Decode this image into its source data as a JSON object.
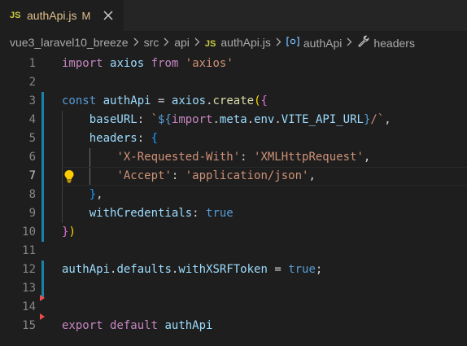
{
  "tab": {
    "badge": "JS",
    "title": "authApi.js",
    "status": "M"
  },
  "breadcrumb": {
    "project": "vue3_laravel10_breeze",
    "folder1": "src",
    "folder2": "api",
    "file_badge": "JS",
    "file": "authApi.js",
    "symbol": "authApi",
    "property": "headers"
  },
  "editor": {
    "active_line": 7,
    "line_numbers": [
      "1",
      "2",
      "3",
      "4",
      "5",
      "6",
      "7",
      "8",
      "9",
      "10",
      "11",
      "12",
      "13",
      "14",
      "15"
    ],
    "lines": [
      [
        {
          "t": "import",
          "c": "k"
        },
        {
          "t": " "
        },
        {
          "t": "axios",
          "c": "v"
        },
        {
          "t": " "
        },
        {
          "t": "from",
          "c": "k"
        },
        {
          "t": " "
        },
        {
          "t": "'axios'",
          "c": "s"
        }
      ],
      [],
      [
        {
          "t": "const",
          "c": "b"
        },
        {
          "t": " "
        },
        {
          "t": "authApi",
          "c": "v"
        },
        {
          "t": " = "
        },
        {
          "t": "axios",
          "c": "v"
        },
        {
          "t": "."
        },
        {
          "t": "create",
          "c": "f"
        },
        {
          "t": "(",
          "c": "y"
        },
        {
          "t": "{",
          "c": "p"
        }
      ],
      [
        {
          "t": "    "
        },
        {
          "t": "baseURL",
          "c": "v"
        },
        {
          "t": ": "
        },
        {
          "t": "`",
          "c": "s"
        },
        {
          "t": "${",
          "c": "b"
        },
        {
          "t": "import",
          "c": "k"
        },
        {
          "t": "."
        },
        {
          "t": "meta",
          "c": "v"
        },
        {
          "t": "."
        },
        {
          "t": "env",
          "c": "v"
        },
        {
          "t": "."
        },
        {
          "t": "VITE_API_URL",
          "c": "v"
        },
        {
          "t": "}",
          "c": "b"
        },
        {
          "t": "/`",
          "c": "s"
        },
        {
          "t": ","
        }
      ],
      [
        {
          "t": "    "
        },
        {
          "t": "headers",
          "c": "v"
        },
        {
          "t": ": "
        },
        {
          "t": "{",
          "c": "bb"
        }
      ],
      [
        {
          "t": "        "
        },
        {
          "t": "'X-Requested-With'",
          "c": "s"
        },
        {
          "t": ": "
        },
        {
          "t": "'XMLHttpRequest'",
          "c": "s"
        },
        {
          "t": ","
        }
      ],
      [
        {
          "t": "        "
        },
        {
          "t": "'Accept'",
          "c": "s"
        },
        {
          "t": ": "
        },
        {
          "t": "'application/json'",
          "c": "s"
        },
        {
          "t": ","
        }
      ],
      [
        {
          "t": "    "
        },
        {
          "t": "}",
          "c": "bb"
        },
        {
          "t": ","
        }
      ],
      [
        {
          "t": "    "
        },
        {
          "t": "withCredentials",
          "c": "v"
        },
        {
          "t": ": "
        },
        {
          "t": "true",
          "c": "b"
        }
      ],
      [
        {
          "t": "}",
          "c": "p"
        },
        {
          "t": ")",
          "c": "y"
        }
      ],
      [],
      [
        {
          "t": "authApi",
          "c": "v"
        },
        {
          "t": "."
        },
        {
          "t": "defaults",
          "c": "v"
        },
        {
          "t": "."
        },
        {
          "t": "withXSRFToken",
          "c": "v"
        },
        {
          "t": " = "
        },
        {
          "t": "true",
          "c": "b"
        },
        {
          "t": ";"
        }
      ],
      [],
      [],
      [
        {
          "t": "export",
          "c": "k"
        },
        {
          "t": " "
        },
        {
          "t": "default",
          "c": "k"
        },
        {
          "t": " "
        },
        {
          "t": "authApi",
          "c": "v"
        }
      ]
    ],
    "gutter_changes": [
      "none",
      "none",
      "modified",
      "modified",
      "modified",
      "modified",
      "modified",
      "modified",
      "modified",
      "modified",
      "none",
      "modified",
      "modified",
      "deleted",
      "deleted"
    ]
  },
  "colors": {
    "background": "#1e1e1e",
    "tab_modified": "#e2c08d",
    "js_badge": "#cbcb41",
    "gutter_modified": "#1b81a8",
    "gutter_deleted": "#f14c4c",
    "lightbulb": "#ffcc00"
  },
  "icons": {
    "tab_close": "close-icon",
    "crumb_sep": "chevron-right-icon",
    "symbol": "symbol-variable-icon",
    "property": "wrench-icon",
    "lightbulb": "lightbulb-icon"
  }
}
